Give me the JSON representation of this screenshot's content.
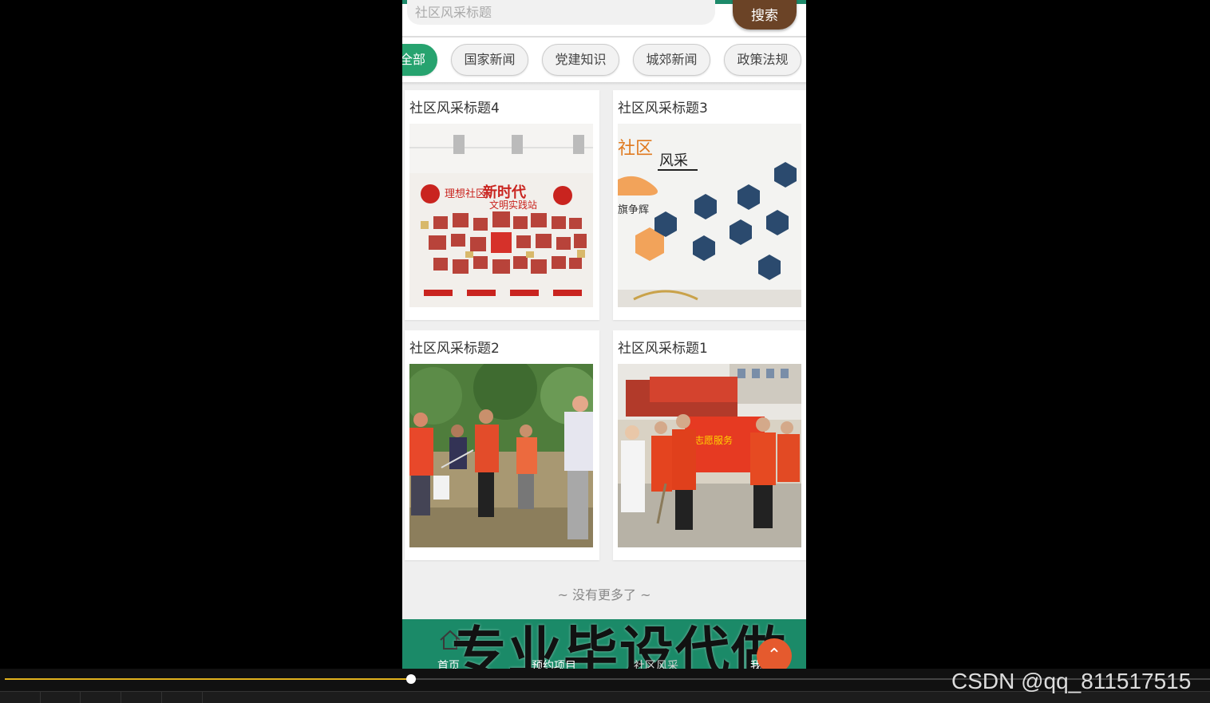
{
  "search": {
    "placeholder": "社区风采标题",
    "button_label": "搜索"
  },
  "tabs": [
    {
      "label": "全部",
      "active": true
    },
    {
      "label": "国家新闻",
      "active": false
    },
    {
      "label": "党建知识",
      "active": false
    },
    {
      "label": "城郊新闻",
      "active": false
    },
    {
      "label": "政策法规",
      "active": false
    }
  ],
  "cards": [
    {
      "title": "社区风采标题4"
    },
    {
      "title": "社区风采标题3"
    },
    {
      "title": "社区风采标题2"
    },
    {
      "title": "社区风采标题1"
    }
  ],
  "list_footer": "~ 没有更多了 ~",
  "bottom_nav": {
    "items": [
      {
        "label": "首页",
        "icon": "home-icon"
      },
      {
        "label": "预约项目",
        "icon": ""
      },
      {
        "label": "社区风采",
        "icon": ""
      },
      {
        "label": "我的",
        "icon": ""
      }
    ],
    "overlay_text": "专业毕设代做",
    "up_icon": "arrow-up-icon"
  },
  "player": {
    "progress": 0.337,
    "watermark": "CSDN @qq_811517515"
  },
  "colors": {
    "accent_green": "#27a36f",
    "nav_green": "#1b8a68",
    "search_button": "#6b4326",
    "progress": "#e2b21d"
  }
}
